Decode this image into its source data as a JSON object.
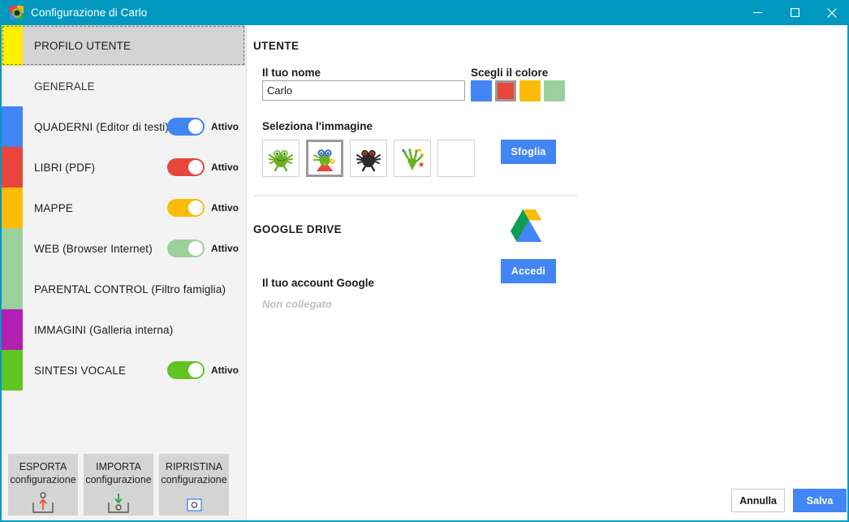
{
  "window": {
    "title": "Configurazione di Carlo",
    "accent_color": "#0098bf",
    "minimize_label": "Riduci a icona",
    "maximize_label": "Ingrandisci",
    "close_label": "Chiudi"
  },
  "sidebar": {
    "items": [
      {
        "label": "PROFILO UTENTE",
        "color": "#ffef00",
        "selected": true,
        "toggle": null
      },
      {
        "label": "GENERALE",
        "color": "#f3f3f3",
        "selected": false,
        "toggle": null
      },
      {
        "label": "QUADERNI (Editor di testi)",
        "color": "#4285f4",
        "selected": false,
        "toggle": {
          "state": "Attivo",
          "on": true,
          "color": "#4285f4"
        }
      },
      {
        "label": "LIBRI (PDF)",
        "color": "#e8453c",
        "selected": false,
        "toggle": {
          "state": "Attivo",
          "on": true,
          "color": "#e8453c"
        }
      },
      {
        "label": "MAPPE",
        "color": "#fcbc05",
        "selected": false,
        "toggle": {
          "state": "Attivo",
          "on": true,
          "color": "#fcbc05"
        }
      },
      {
        "label": "WEB (Browser Internet)",
        "color": "#9bcf9b",
        "selected": false,
        "toggle": {
          "state": "Attivo",
          "on": true,
          "color": "#9bcf9b"
        }
      },
      {
        "label": "PARENTAL CONTROL (Filtro famiglia)",
        "color": "#9bcf9b",
        "selected": false,
        "toggle": null
      },
      {
        "label": "IMMAGINI (Galleria interna)",
        "color": "#b31fb3",
        "selected": false,
        "toggle": null
      },
      {
        "label": "SINTESI VOCALE",
        "color": "#62c423",
        "selected": false,
        "toggle": {
          "state": "Attivo",
          "on": true,
          "color": "#62c423"
        }
      }
    ],
    "buttons": [
      {
        "line1": "ESPORTA",
        "line2": "configurazione",
        "icon": "export-config-icon"
      },
      {
        "line1": "IMPORTA",
        "line2": "configurazione",
        "icon": "import-config-icon"
      },
      {
        "line1": "RIPRISTINA",
        "line2": "configurazione",
        "icon": "restore-config-icon"
      }
    ]
  },
  "main": {
    "user_section": {
      "title": "UTENTE",
      "name_label": "Il tuo nome",
      "name_value": "Carlo",
      "name_placeholder": "Il tuo nome",
      "color_label": "Scegli il colore",
      "colors": [
        {
          "hex": "#4285f4",
          "selected": false
        },
        {
          "hex": "#e8453c",
          "selected": true
        },
        {
          "hex": "#fcbc05",
          "selected": false
        },
        {
          "hex": "#9bcf9b",
          "selected": false
        }
      ],
      "image_label": "Seleziona l'immagine",
      "images": [
        {
          "name": "frog-green-avatar",
          "selected": false
        },
        {
          "name": "frog-hero-avatar",
          "selected": true
        },
        {
          "name": "frog-black-avatar",
          "selected": false
        },
        {
          "name": "frog-sparkle-avatar",
          "selected": false
        },
        {
          "name": "empty-avatar-slot",
          "selected": false
        }
      ],
      "browse_button": "Sfoglia"
    },
    "drive_section": {
      "title": "GOOGLE DRIVE",
      "logo": "google-drive-logo",
      "account_label": "Il tuo account Google",
      "account_status": "Non collegato",
      "login_button": "Accedi"
    },
    "footer": {
      "cancel_label": "Annulla",
      "save_label": "Salva"
    }
  }
}
